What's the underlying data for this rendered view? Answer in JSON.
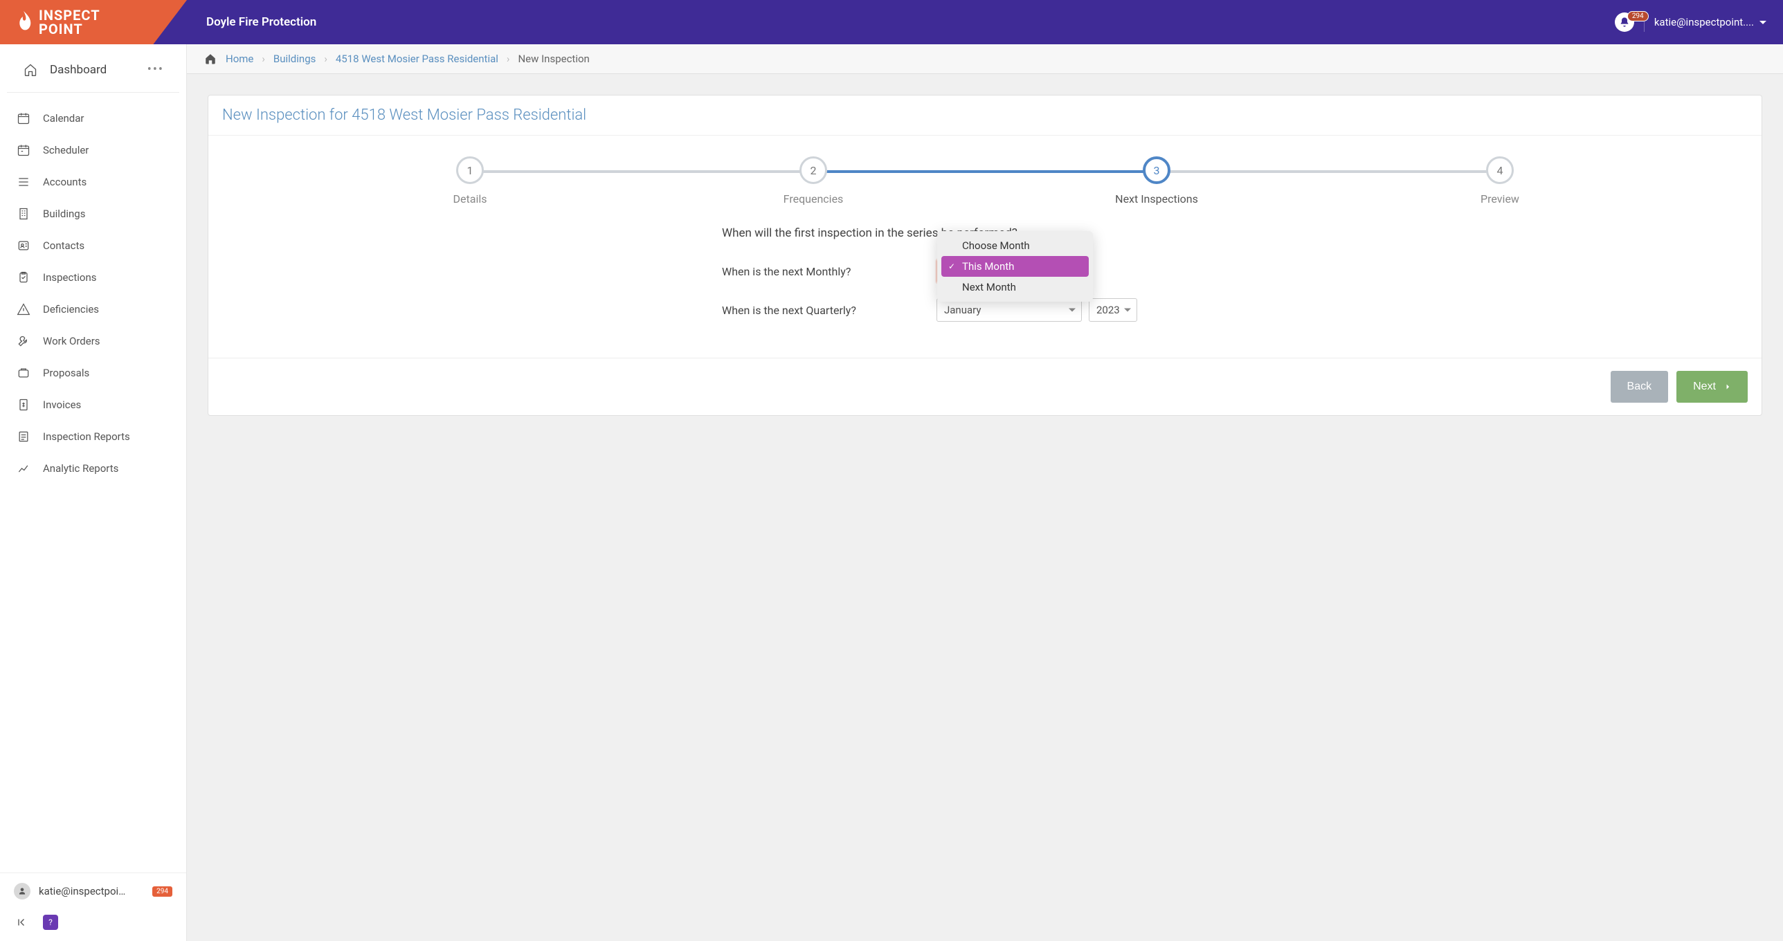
{
  "header": {
    "brand_top": "INSPECT",
    "brand_bottom": "POINT",
    "company": "Doyle Fire Protection",
    "notification_count": "294",
    "user_email": "katie@inspectpoint...."
  },
  "sidebar": {
    "dashboard": "Dashboard",
    "items": [
      {
        "label": "Calendar",
        "icon": "calendar"
      },
      {
        "label": "Scheduler",
        "icon": "scheduler"
      },
      {
        "label": "Accounts",
        "icon": "accounts"
      },
      {
        "label": "Buildings",
        "icon": "buildings"
      },
      {
        "label": "Contacts",
        "icon": "contacts"
      },
      {
        "label": "Inspections",
        "icon": "inspections"
      },
      {
        "label": "Deficiencies",
        "icon": "deficiencies"
      },
      {
        "label": "Work Orders",
        "icon": "workorders"
      },
      {
        "label": "Proposals",
        "icon": "proposals"
      },
      {
        "label": "Invoices",
        "icon": "invoices"
      },
      {
        "label": "Inspection Reports",
        "icon": "reports"
      },
      {
        "label": "Analytic Reports",
        "icon": "analytics"
      }
    ],
    "footer_email": "katie@inspectpoint....",
    "footer_badge": "294"
  },
  "breadcrumb": {
    "home": "Home",
    "buildings": "Buildings",
    "building_name": "4518 West Mosier Pass Residential",
    "current": "New Inspection"
  },
  "card": {
    "title": "New Inspection for 4518 West Mosier Pass Residential",
    "steps": [
      {
        "num": "1",
        "label": "Details"
      },
      {
        "num": "2",
        "label": "Frequencies"
      },
      {
        "num": "3",
        "label": "Next Inspections"
      },
      {
        "num": "4",
        "label": "Preview"
      }
    ],
    "heading": "When will the first inspection in the series be performed?",
    "monthly_label": "When is the next Monthly?",
    "quarterly_label": "When is the next Quarterly?",
    "month_dropdown": {
      "options": [
        "Choose Month",
        "This Month",
        "Next Month"
      ],
      "selected": "This Month"
    },
    "quarterly_month_value": "January",
    "quarterly_year_value": "2023",
    "back_label": "Back",
    "next_label": "Next"
  }
}
